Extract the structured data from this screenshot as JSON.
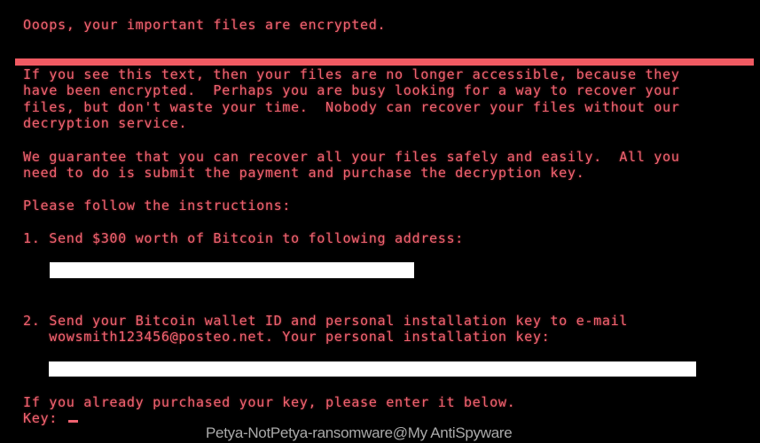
{
  "title": "Ooops, your important files are encrypted.",
  "paragraph1": [
    "If you see this text, then your files are no longer accessible, because they",
    "have been encrypted.  Perhaps you are busy looking for a way to recover your",
    "files, but don't waste your time.  Nobody can recover your files without our",
    "decryption service."
  ],
  "paragraph2": [
    "We guarantee that you can recover all your files safely and easily.  All you",
    "need to do is submit the payment and purchase the decryption key."
  ],
  "instructions_heading": "Please follow the instructions:",
  "step1": "1. Send $300 worth of Bitcoin to following address:",
  "step2": [
    "2. Send your Bitcoin wallet ID and personal installation key to e-mail",
    "   wowsmith123456@posteo.net. Your personal installation key:"
  ],
  "key_prompt_text": "If you already purchased your key, please enter it below.",
  "key_label": "Key: ",
  "key_value": "",
  "watermark": "Petya-NotPetya-ransomware@My AntiSpyware",
  "colors": {
    "text": "#ef6270",
    "bar": "#f05a62",
    "background": "#000000"
  }
}
